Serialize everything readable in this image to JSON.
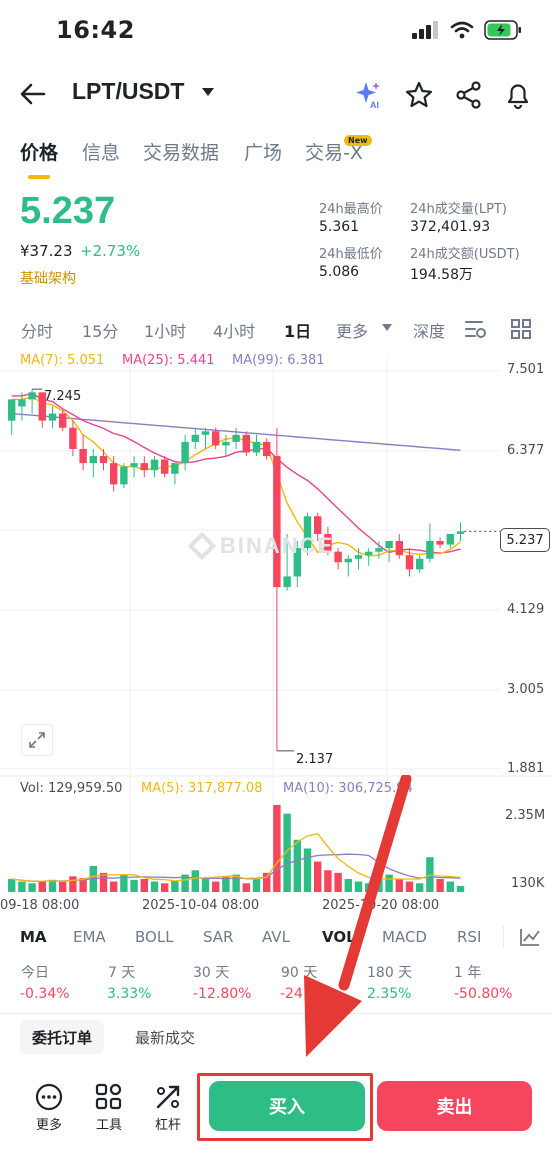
{
  "status_bar": {
    "time": "16:42"
  },
  "header": {
    "pair": "LPT/USDT"
  },
  "tabs": [
    {
      "label": "价格",
      "active": true
    },
    {
      "label": "信息"
    },
    {
      "label": "交易数据"
    },
    {
      "label": "广场"
    },
    {
      "label": "交易-X"
    }
  ],
  "new_badge": "New",
  "price": {
    "last": "5.237",
    "cny": "¥37.23",
    "change": "+2.73%",
    "tag": "基础架构"
  },
  "stats": {
    "high_label": "24h最高价",
    "high": "5.361",
    "vol_label": "24h成交量(LPT)",
    "vol": "372,401.93",
    "low_label": "24h最低价",
    "low": "5.086",
    "amt_label": "24h成交额(USDT)",
    "amt": "194.58万"
  },
  "intervals": [
    "分时",
    "15分",
    "1小时",
    "4小时",
    "1日",
    "更多",
    "深度"
  ],
  "active_interval": "1日",
  "ma_legend": {
    "ma7": "MA(7): 5.051",
    "ma25": "MA(25): 5.441",
    "ma99": "MA(99): 6.381"
  },
  "chart_data": {
    "type": "candlestick",
    "y_axis_ticks": [
      "7.501",
      "6.377",
      "5.237",
      "4.129",
      "3.005",
      "1.881"
    ],
    "x_axis_ticks": [
      "09-18 08:00",
      "2025-10-04 08:00",
      "2025-10-20 08:00"
    ],
    "high_annotation": "7.245",
    "low_annotation": "2.137",
    "last_price": "5.237",
    "watermark": "BINANCE",
    "candles": [
      {
        "o": 6.8,
        "h": 7.0,
        "l": 6.6,
        "c": 7.1
      },
      {
        "o": 7.0,
        "h": 7.2,
        "l": 6.8,
        "c": 7.1
      },
      {
        "o": 7.1,
        "h": 7.245,
        "l": 6.9,
        "c": 7.2
      },
      {
        "o": 7.2,
        "h": 7.2,
        "l": 6.7,
        "c": 6.8
      },
      {
        "o": 6.8,
        "h": 7.0,
        "l": 6.7,
        "c": 6.9
      },
      {
        "o": 6.9,
        "h": 6.95,
        "l": 6.65,
        "c": 6.7
      },
      {
        "o": 6.7,
        "h": 6.8,
        "l": 6.3,
        "c": 6.4
      },
      {
        "o": 6.4,
        "h": 6.6,
        "l": 6.1,
        "c": 6.2
      },
      {
        "o": 6.2,
        "h": 6.4,
        "l": 6.0,
        "c": 6.3
      },
      {
        "o": 6.3,
        "h": 6.4,
        "l": 6.1,
        "c": 6.2
      },
      {
        "o": 6.2,
        "h": 6.3,
        "l": 5.8,
        "c": 5.9
      },
      {
        "o": 5.9,
        "h": 6.2,
        "l": 5.85,
        "c": 6.15
      },
      {
        "o": 6.15,
        "h": 6.3,
        "l": 6.0,
        "c": 6.2
      },
      {
        "o": 6.2,
        "h": 6.3,
        "l": 6.0,
        "c": 6.1
      },
      {
        "o": 6.1,
        "h": 6.3,
        "l": 6.0,
        "c": 6.25
      },
      {
        "o": 6.25,
        "h": 6.3,
        "l": 6.0,
        "c": 6.05
      },
      {
        "o": 6.05,
        "h": 6.2,
        "l": 5.9,
        "c": 6.2
      },
      {
        "o": 6.2,
        "h": 6.6,
        "l": 6.1,
        "c": 6.5
      },
      {
        "o": 6.5,
        "h": 6.7,
        "l": 6.4,
        "c": 6.6
      },
      {
        "o": 6.6,
        "h": 6.7,
        "l": 6.4,
        "c": 6.65
      },
      {
        "o": 6.65,
        "h": 6.7,
        "l": 6.4,
        "c": 6.45
      },
      {
        "o": 6.45,
        "h": 6.6,
        "l": 6.3,
        "c": 6.5
      },
      {
        "o": 6.5,
        "h": 6.7,
        "l": 6.4,
        "c": 6.6
      },
      {
        "o": 6.6,
        "h": 6.65,
        "l": 6.3,
        "c": 6.35
      },
      {
        "o": 6.35,
        "h": 6.6,
        "l": 6.3,
        "c": 6.5
      },
      {
        "o": 6.5,
        "h": 6.55,
        "l": 6.25,
        "c": 6.3
      },
      {
        "o": 6.3,
        "h": 6.7,
        "l": 2.137,
        "c": 4.45
      },
      {
        "o": 4.45,
        "h": 5.2,
        "l": 4.4,
        "c": 4.6
      },
      {
        "o": 4.6,
        "h": 5.1,
        "l": 4.45,
        "c": 5.0
      },
      {
        "o": 5.0,
        "h": 5.5,
        "l": 4.9,
        "c": 5.45
      },
      {
        "o": 5.45,
        "h": 5.5,
        "l": 5.1,
        "c": 5.2
      },
      {
        "o": 5.2,
        "h": 5.3,
        "l": 4.9,
        "c": 4.95
      },
      {
        "o": 4.95,
        "h": 5.0,
        "l": 4.7,
        "c": 4.8
      },
      {
        "o": 4.8,
        "h": 4.9,
        "l": 4.6,
        "c": 4.85
      },
      {
        "o": 4.85,
        "h": 5.0,
        "l": 4.7,
        "c": 4.9
      },
      {
        "o": 4.9,
        "h": 5.0,
        "l": 4.75,
        "c": 4.95
      },
      {
        "o": 4.95,
        "h": 5.1,
        "l": 4.85,
        "c": 5.0
      },
      {
        "o": 5.0,
        "h": 5.1,
        "l": 4.8,
        "c": 5.1
      },
      {
        "o": 5.1,
        "h": 5.2,
        "l": 4.85,
        "c": 4.9
      },
      {
        "o": 4.9,
        "h": 5.0,
        "l": 4.6,
        "c": 4.7
      },
      {
        "o": 4.7,
        "h": 4.9,
        "l": 4.65,
        "c": 4.85
      },
      {
        "o": 4.85,
        "h": 5.35,
        "l": 4.8,
        "c": 5.1
      },
      {
        "o": 5.1,
        "h": 5.15,
        "l": 5.0,
        "c": 5.05
      },
      {
        "o": 5.05,
        "h": 5.2,
        "l": 5.0,
        "c": 5.2
      },
      {
        "o": 5.2,
        "h": 5.36,
        "l": 5.1,
        "c": 5.237
      }
    ]
  },
  "volume": {
    "vol": "Vol: 129,959.50",
    "ma5": "MA(5): 317,877.08",
    "ma10": "MA(10): 306,725.94",
    "y_ticks": [
      "2.35M",
      "130K"
    ],
    "values": [
      0.15,
      0.12,
      0.1,
      0.13,
      0.14,
      0.12,
      0.18,
      0.16,
      0.3,
      0.22,
      0.12,
      0.2,
      0.14,
      0.15,
      0.12,
      0.1,
      0.13,
      0.2,
      0.25,
      0.15,
      0.12,
      0.18,
      0.2,
      0.1,
      0.15,
      0.22,
      1.0,
      0.9,
      0.6,
      0.5,
      0.35,
      0.25,
      0.22,
      0.15,
      0.12,
      0.1,
      0.18,
      0.2,
      0.15,
      0.12,
      0.1,
      0.4,
      0.15,
      0.12,
      0.07
    ]
  },
  "indicators": [
    "MA",
    "EMA",
    "BOLL",
    "SAR",
    "AVL",
    "VOL",
    "MACD",
    "RSI"
  ],
  "performance": [
    {
      "label": "今日",
      "value": "-0.34%",
      "dir": "down"
    },
    {
      "label": "7 天",
      "value": "3.33%",
      "dir": "up"
    },
    {
      "label": "30 天",
      "value": "-12.80%",
      "dir": "down"
    },
    {
      "label": "90 天",
      "value": "-24.9",
      "dir": "down"
    },
    {
      "label": "180 天",
      "value": "2.35%",
      "dir": "up"
    },
    {
      "label": "1 年",
      "value": "-50.80%",
      "dir": "down"
    }
  ],
  "order_tabs": [
    "委托订单",
    "最新成交"
  ],
  "bottom": {
    "more": "更多",
    "tools": "工具",
    "leverage": "杠杆",
    "buy": "买入",
    "sell": "卖出"
  },
  "colors": {
    "up": "#2ebd85",
    "down": "#f6465d",
    "accent": "#f0b90b",
    "ma7": "#f0b90b",
    "ma25": "#e84393",
    "ma99": "#8e7cc3",
    "annotation_arrow": "#e53935"
  }
}
